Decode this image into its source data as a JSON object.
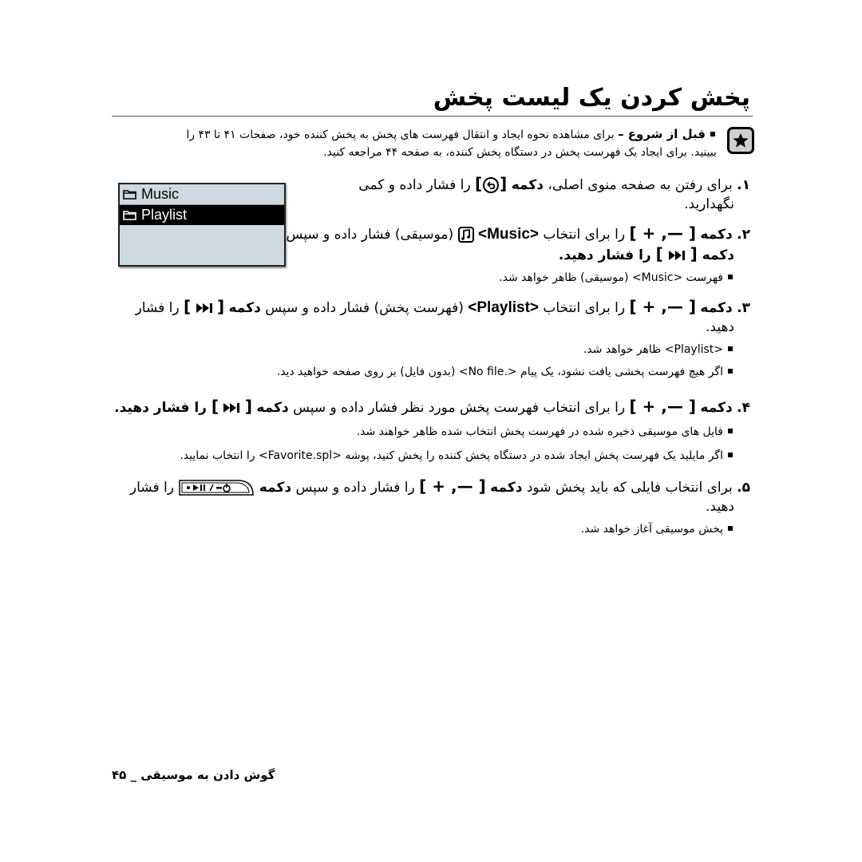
{
  "page": {
    "title": "پخش کردن یک لیست پخش",
    "footer": "گوش دادن به موسیقی _ ۴۵"
  },
  "note": {
    "icon": "star-icon",
    "heading": "قبل از شروع –",
    "line1": " برای مشاهده نحوه ایجاد و انتقال فهرست های پخش به پخش کننده خود، صفحات ۴۱ تا ۴۳ را",
    "line2": "ببینید. برای ایجاد یک فهرست پخش در دستگاه پخش کننده، به صفحه ۴۴ مراجعه کنید."
  },
  "device_screen": {
    "items": [
      {
        "label": "Music",
        "icon": "folder-icon",
        "selected": false
      },
      {
        "label": "Playlist",
        "icon": "folder-icon",
        "selected": true
      }
    ]
  },
  "steps": [
    {
      "number": "۱.",
      "pre": " برای رفتن به صفحه منوی اصلی، ",
      "kw": "دکمه",
      "button_icon": "back-button-icon",
      "post": " را فشار داده و کمی",
      "line2": "نگهدارید."
    },
    {
      "number": "۲.",
      "kw": "دکمه",
      "keys": "+ ,—",
      "mid": " را برای انتخاب ",
      "target": "<Music>",
      "target_icon": "music-note-icon",
      "post": " (موسیقی) فشار داده و سپس",
      "line2_kw": "دکمه",
      "line2_key_icon": "next-track-icon",
      "line2_post": " را فشار دهید.",
      "bullets": [
        "فهرست <Music> (موسیقی) ظاهر خواهد شد."
      ]
    },
    {
      "number": "۳.",
      "kw": "دکمه",
      "keys": "+ ,—",
      "mid": " را برای انتخاب ",
      "target": "<Playlist>",
      "post": " (فهرست پخش) فشار داده و سپس ",
      "kw2": "دکمه",
      "key_icon": "next-track-icon",
      "post2": " را فشار",
      "line2": "دهید.",
      "bullets": [
        "<Playlist> ظاهر خواهد شد.",
        "اگر هیچ فهرست پخشی یافت نشود، یک پیام <.No file> (بدون فایل) بر روی صفحه خواهید دید."
      ]
    },
    {
      "number": "۴.",
      "kw": "دکمه",
      "keys": "+ ,—",
      "mid": " را برای انتخاب فهرست پخش مورد نظر فشار داده و سپس ",
      "kw2": "دکمه",
      "key_icon": "next-track-icon",
      "post2": " را فشار دهید.",
      "bullets": [
        "فایل های موسیقی ذخیره شده در فهرست پخش انتخاب شده ظاهر خواهند شد.",
        "اگر مایلید یک فهرست پخش ایجاد شده در دستگاه پخش کننده را پخش کنید، پوشه <Favorite.spl> را انتخاب نمایید."
      ]
    },
    {
      "number": "۵.",
      "pre": " برای انتخاب فایلی که باید پخش شود ",
      "kw": "دکمه",
      "keys": "+ ,—",
      "mid": " را فشار داده و سپس ",
      "kw2": "دکمه",
      "key_icon": "play-pause-power-button-icon",
      "post2": " را فشار",
      "line2": "دهید.",
      "bullets": [
        "پخش موسیقی آغاز خواهد شد."
      ]
    }
  ]
}
